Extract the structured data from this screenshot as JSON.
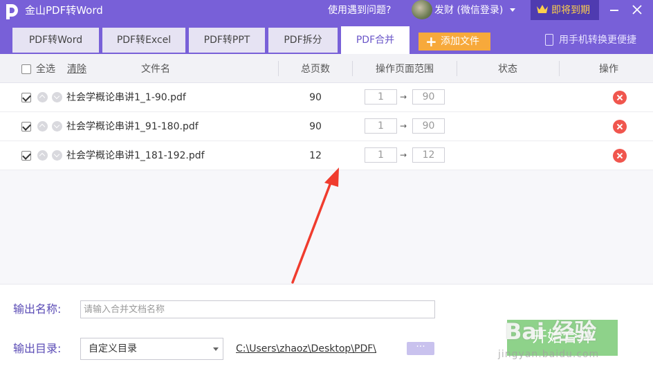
{
  "titlebar": {
    "app_title": "金山PDF转Word",
    "help": "使用遇到问题?",
    "user_name": "发财 (微信登录)",
    "vip_label": "即将到期"
  },
  "tabs": [
    {
      "label": "PDF转Word",
      "active": false
    },
    {
      "label": "PDF转Excel",
      "active": false
    },
    {
      "label": "PDF转PPT",
      "active": false
    },
    {
      "label": "PDF拆分",
      "active": false
    },
    {
      "label": "PDF合并",
      "active": true
    }
  ],
  "toolbar": {
    "add_file_label": "添加文件",
    "phone_label": "用手机转换更便捷"
  },
  "table": {
    "select_all": "全选",
    "clear": "清除",
    "columns": {
      "file_name": "文件名",
      "total_pages": "总页数",
      "page_range": "操作页面范围",
      "status": "状态",
      "action": "操作"
    },
    "rows": [
      {
        "file_name": "社会学概论串讲1_1-90.pdf",
        "pages": "90",
        "range_from": "1",
        "range_to": "90",
        "checked": true,
        "status": ""
      },
      {
        "file_name": "社会学概论串讲1_91-180.pdf",
        "pages": "90",
        "range_from": "1",
        "range_to": "90",
        "checked": true,
        "status": ""
      },
      {
        "file_name": "社会学概论串讲1_181-192.pdf",
        "pages": "12",
        "range_from": "1",
        "range_to": "12",
        "checked": true,
        "status": ""
      }
    ],
    "range_arrow": "→"
  },
  "output": {
    "name_label": "输出名称:",
    "name_placeholder": "请输入合并文档名称",
    "name_value": "",
    "dir_label": "输出目录:",
    "dir_selected": "自定义目录",
    "dir_path": "C:\\Users\\zhaoz\\Desktop\\PDF\\",
    "browse_label": "···",
    "start_label": "开始合并"
  },
  "watermark": {
    "brand": "Bai 经验",
    "url": "jingyan.baidu.com"
  },
  "colors": {
    "brand_purple": "#7860d8",
    "vip_gold": "#fccf4b",
    "add_file_orange": "#f7a93b",
    "delete_red": "#f0564e",
    "start_green": "#8ed28a",
    "annotation_red": "#f03c2e"
  }
}
